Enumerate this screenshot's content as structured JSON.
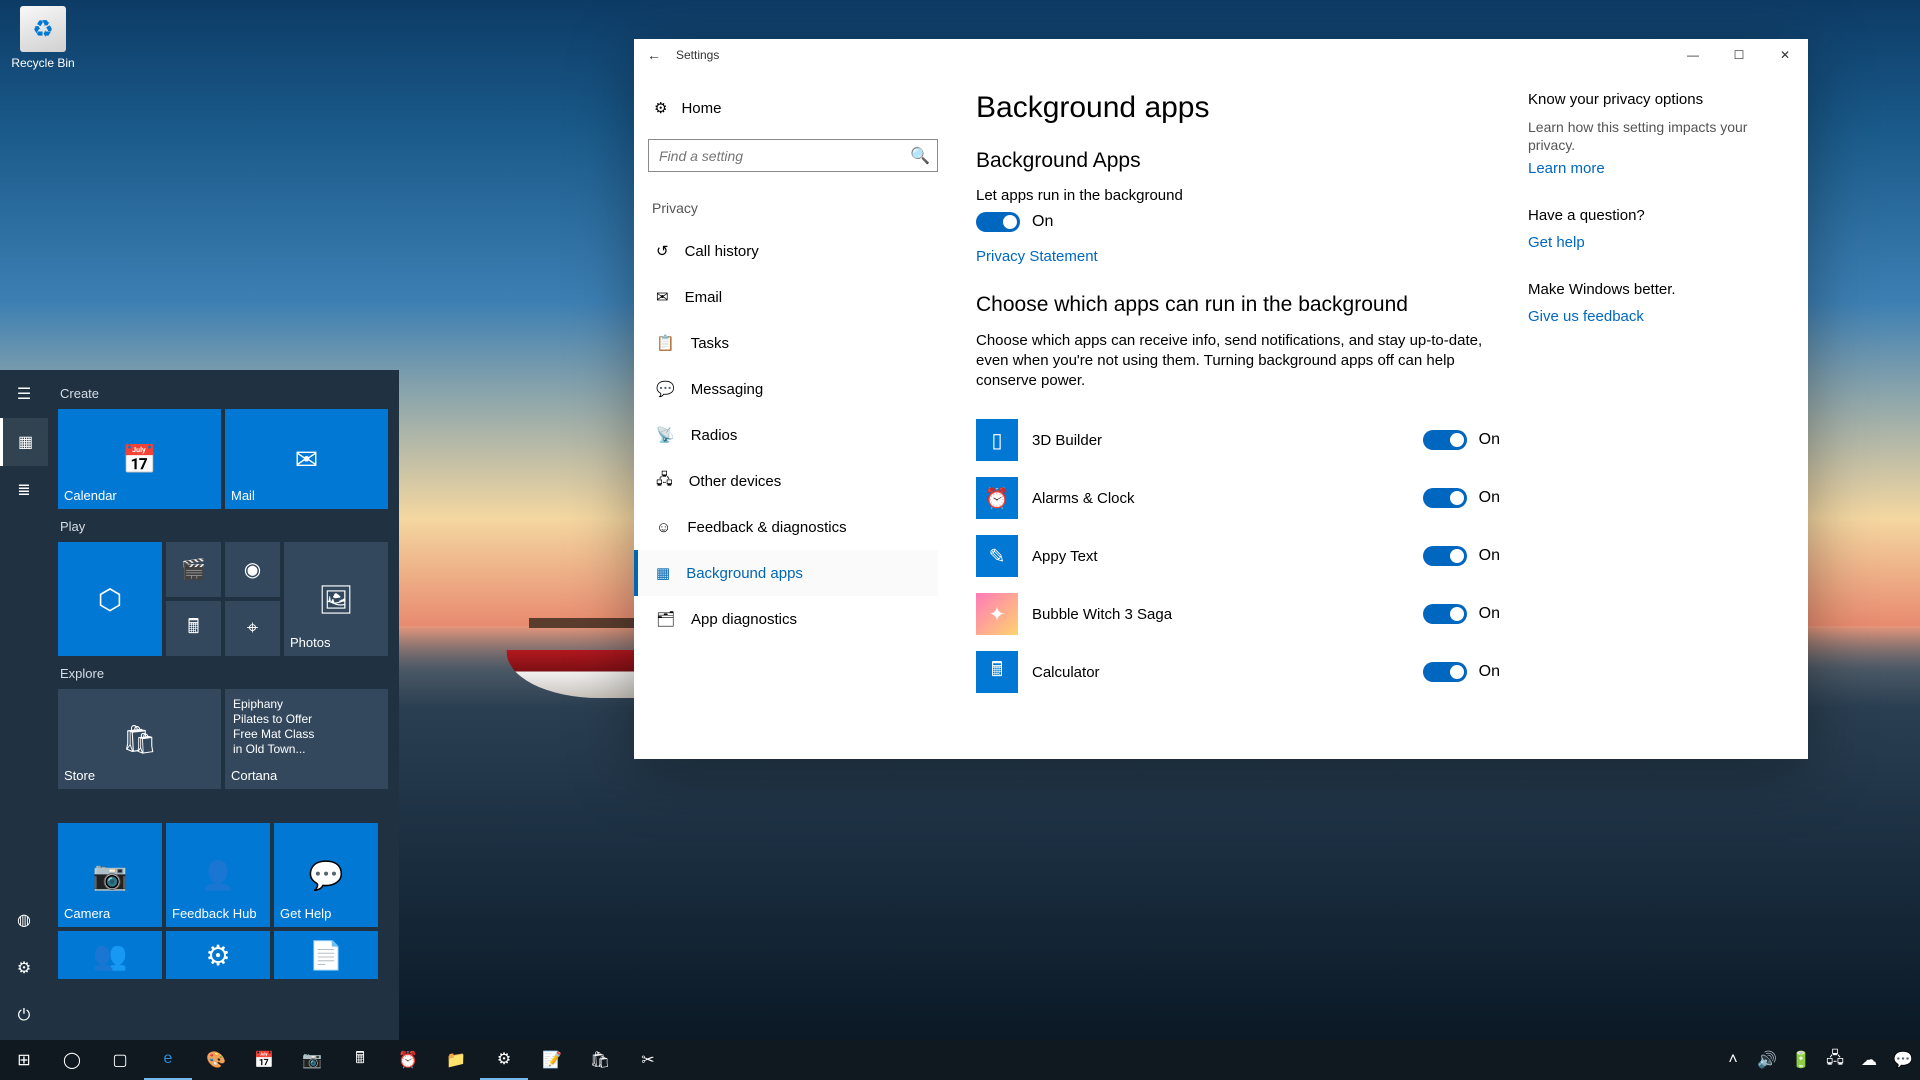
{
  "desktop": {
    "recycle_bin": "Recycle Bin"
  },
  "start": {
    "groups": {
      "create": "Create",
      "play": "Play",
      "explore": "Explore"
    },
    "tiles": {
      "calendar": "Calendar",
      "mail": "Mail",
      "photos": "Photos",
      "store": "Store",
      "cortana": "Cortana",
      "cortana_text": "Epiphany\nPilates to Offer\nFree Mat Class\nin Old Town...",
      "camera": "Camera",
      "feedback": "Feedback Hub",
      "gethelp": "Get Help"
    }
  },
  "settings": {
    "window_title": "Settings",
    "home": "Home",
    "search_placeholder": "Find a setting",
    "category": "Privacy",
    "nav": [
      "Call history",
      "Email",
      "Tasks",
      "Messaging",
      "Radios",
      "Other devices",
      "Feedback & diagnostics",
      "Background apps",
      "App diagnostics"
    ],
    "page_title": "Background apps",
    "section1_title": "Background Apps",
    "master_toggle_label": "Let apps run in the background",
    "master_toggle_state": "On",
    "privacy_link": "Privacy Statement",
    "section2_title": "Choose which apps can run in the background",
    "section2_desc": "Choose which apps can receive info, send notifications, and stay up-to-date, even when you're not using them. Turning background apps off can help conserve power.",
    "apps": [
      {
        "name": "3D Builder",
        "state": "On"
      },
      {
        "name": "Alarms & Clock",
        "state": "On"
      },
      {
        "name": "Appy Text",
        "state": "On"
      },
      {
        "name": "Bubble Witch 3 Saga",
        "state": "On"
      },
      {
        "name": "Calculator",
        "state": "On"
      }
    ],
    "aside": {
      "h1": "Know your privacy options",
      "p1": "Learn how this setting impacts your privacy.",
      "l1": "Learn more",
      "h2": "Have a question?",
      "l2": "Get help",
      "h3": "Make Windows better.",
      "l3": "Give us feedback"
    }
  }
}
